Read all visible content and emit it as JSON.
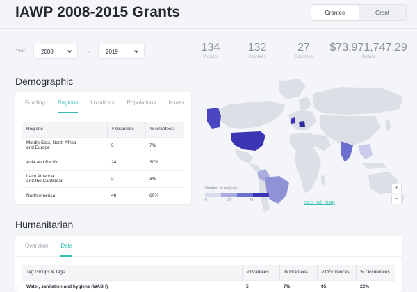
{
  "header": {
    "title": "IAWP 2008-2015 Grants",
    "toggle": [
      "Grantee",
      "Grant"
    ]
  },
  "filters": {
    "year_label": "Year",
    "from_year": "2008",
    "dash": "-",
    "to_year": "2019"
  },
  "stats": [
    {
      "value": "134",
      "label": "Projects"
    },
    {
      "value": "132",
      "label": "Grantees"
    },
    {
      "value": "27",
      "label": "Countries"
    },
    {
      "value": "$73,971,747.29",
      "label": "Dollars"
    }
  ],
  "demographic": {
    "title": "Demographic",
    "tabs": [
      "Funding",
      "Regions",
      "Locations",
      "Populations",
      "Issues"
    ],
    "active_tab": "Regions",
    "table": {
      "headers": [
        "Regions",
        "# Grantees",
        "% Grantees"
      ],
      "rows": [
        {
          "region_line1": "Middle East, North Africa",
          "region_line2": "and Europe",
          "grantees": "5",
          "pct": "7%"
        },
        {
          "region_line1": "Asia and Pacific",
          "region_line2": "",
          "grantees": "24",
          "pct": "30%"
        },
        {
          "region_line1": "Latin America",
          "region_line2": "and the Caribbean",
          "grantees": "2",
          "pct": "3%"
        },
        {
          "region_line1": "North America",
          "region_line2": "",
          "grantees": "48",
          "pct": "60%"
        }
      ]
    }
  },
  "map": {
    "legend_title": "Number of projects",
    "legend_ticks": [
      "0",
      "24",
      "48"
    ],
    "legend_colors": [
      "#d9dcef",
      "#a9addf",
      "#6d6fcf",
      "#3b35b5"
    ],
    "see_full_map": "see full map",
    "zoom_in": "+",
    "zoom_out": "−",
    "land_color": "#dcdfe5",
    "scale_low": "#c9cbea",
    "scale_high": "#3b35b5"
  },
  "humanitarian": {
    "title": "Humanitarian",
    "tabs": [
      "Overview",
      "Data"
    ],
    "active_tab": "Data",
    "table": {
      "headers": [
        "Tag Groups & Tags",
        "# Grantees",
        "% Grantees",
        "# Occurences",
        "% Occurences"
      ],
      "rows": [
        {
          "tag": "Water, sanitation and hygiene (WASH)",
          "grantees": "5",
          "pct_grantees": "7%",
          "occurences": "95",
          "pct_occurences": "22%"
        }
      ]
    }
  },
  "colors": {
    "accent": "#35c1b2",
    "text": "#2b2f3a",
    "background": "#f4f5f8"
  }
}
